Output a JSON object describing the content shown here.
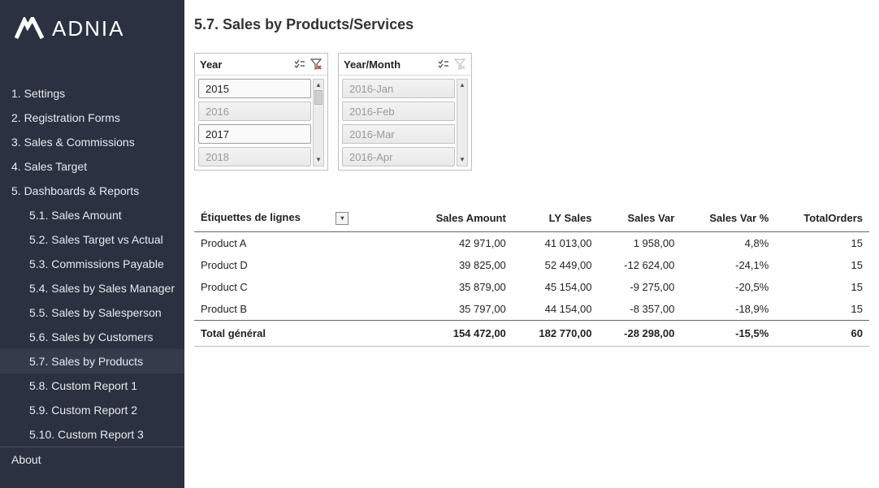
{
  "brand": "ADNIA",
  "sidebar": {
    "items": [
      {
        "label": "1. Settings"
      },
      {
        "label": "2. Registration Forms"
      },
      {
        "label": "3. Sales & Commissions"
      },
      {
        "label": "4. Sales Target"
      },
      {
        "label": "5. Dashboards & Reports"
      }
    ],
    "sub_items": [
      {
        "label": "5.1. Sales Amount"
      },
      {
        "label": "5.2. Sales Target vs Actual"
      },
      {
        "label": "5.3. Commissions Payable"
      },
      {
        "label": "5.4. Sales by Sales Manager"
      },
      {
        "label": "5.5. Sales by Salesperson"
      },
      {
        "label": "5.6. Sales by Customers"
      },
      {
        "label": "5.7. Sales by Products"
      },
      {
        "label": "5.8. Custom Report 1"
      },
      {
        "label": "5.9. Custom Report 2"
      },
      {
        "label": "5.10. Custom Report 3"
      }
    ],
    "about": "About"
  },
  "page_title": "5.7. Sales by Products/Services",
  "slicers": {
    "year": {
      "title": "Year",
      "options": [
        {
          "label": "2015",
          "faded": false
        },
        {
          "label": "2016",
          "faded": true
        },
        {
          "label": "2017",
          "faded": false
        },
        {
          "label": "2018",
          "faded": true
        }
      ]
    },
    "yearmonth": {
      "title": "Year/Month",
      "options": [
        {
          "label": "2016-Jan",
          "faded": true
        },
        {
          "label": "2016-Feb",
          "faded": true
        },
        {
          "label": "2016-Mar",
          "faded": true
        },
        {
          "label": "2016-Apr",
          "faded": true
        }
      ]
    }
  },
  "table": {
    "columns": [
      "Étiquettes de lignes",
      "Sales Amount",
      "LY Sales",
      "Sales Var",
      "Sales Var %",
      "TotalOrders"
    ],
    "rows": [
      {
        "label": "Product A",
        "sales_amount": "42 971,00",
        "ly_sales": "41 013,00",
        "sales_var": "1 958,00",
        "sales_var_pct": "4,8%",
        "total_orders": "15"
      },
      {
        "label": "Product D",
        "sales_amount": "39 825,00",
        "ly_sales": "52 449,00",
        "sales_var": "-12 624,00",
        "sales_var_pct": "-24,1%",
        "total_orders": "15"
      },
      {
        "label": "Product C",
        "sales_amount": "35 879,00",
        "ly_sales": "45 154,00",
        "sales_var": "-9 275,00",
        "sales_var_pct": "-20,5%",
        "total_orders": "15"
      },
      {
        "label": "Product B",
        "sales_amount": "35 797,00",
        "ly_sales": "44 154,00",
        "sales_var": "-8 357,00",
        "sales_var_pct": "-18,9%",
        "total_orders": "15"
      }
    ],
    "total": {
      "label": "Total général",
      "sales_amount": "154 472,00",
      "ly_sales": "182 770,00",
      "sales_var": "-28 298,00",
      "sales_var_pct": "-15,5%",
      "total_orders": "60"
    }
  }
}
